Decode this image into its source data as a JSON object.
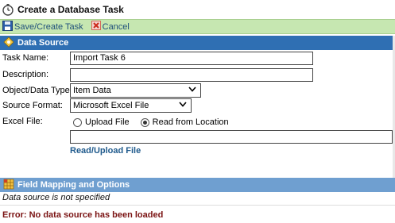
{
  "window": {
    "title": "Create a Database Task"
  },
  "toolbar": {
    "save_label": "Save/Create Task",
    "cancel_label": "Cancel"
  },
  "data_source": {
    "header": "Data Source",
    "task_name_label": "Task Name:",
    "task_name_value": "Import Task 6",
    "description_label": "Description:",
    "description_value": "",
    "object_type_label": "Object/Data Type:",
    "object_type_value": "Item Data",
    "source_format_label": "Source Format:",
    "source_format_value": "Microsoft Excel File",
    "excel_file_label": "Excel File:",
    "radio_upload": "Upload File",
    "radio_location": "Read from Location",
    "location_value": "",
    "upload_link": "Read/Upload File"
  },
  "field_mapping": {
    "header": "Field Mapping and Options",
    "status": "Data source is not specified",
    "error": "Error: No data source has been loaded"
  },
  "colors": {
    "toolbar_bg": "#c6e7b1",
    "section_header_bg": "#2f6fb3",
    "section_header_inactive_bg": "#6f9fd0",
    "error": "#7a1212",
    "link": "#1f5a8c"
  },
  "icons": {
    "title": "stopwatch-icon",
    "save": "floppy-disk-icon",
    "cancel": "red-x-icon",
    "data_source": "database-gear-icon",
    "field_mapping": "grid-table-icon"
  }
}
